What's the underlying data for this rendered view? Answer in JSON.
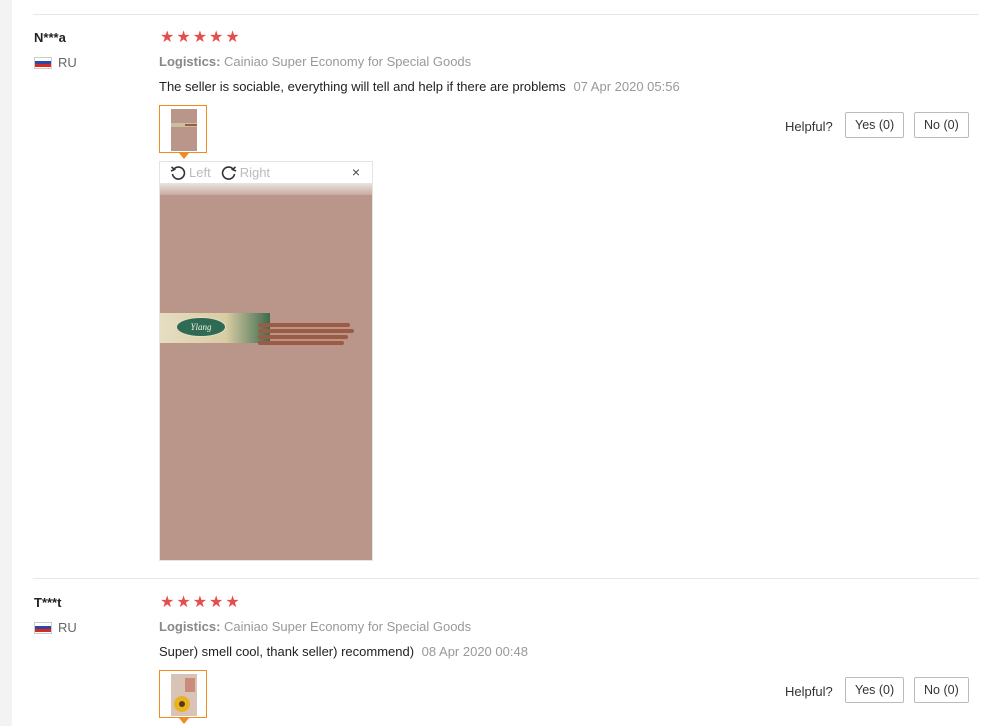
{
  "reviews": [
    {
      "user": "N***a",
      "country": "RU",
      "stars": 5,
      "logistics_label": "Logistics:",
      "logistics_value": "Cainiao Super Economy for Special Goods",
      "text": "The seller is sociable, everything will tell and help if there are problems",
      "date": "07 Apr 2020 05:56",
      "helpful_label": "Helpful?",
      "yes_label": "Yes (0)",
      "no_label": "No (0)",
      "viewer": {
        "left_label": "Left",
        "right_label": "Right",
        "close_label": "×",
        "image_text": "Ylang"
      }
    },
    {
      "user": "T***t",
      "country": "RU",
      "stars": 5,
      "logistics_label": "Logistics:",
      "logistics_value": "Cainiao Super Economy for Special Goods",
      "text": "Super) smell cool, thank seller) recommend)",
      "date": "08 Apr 2020 00:48",
      "helpful_label": "Helpful?",
      "yes_label": "Yes (0)",
      "no_label": "No (0)"
    }
  ],
  "icons": {
    "star": "★",
    "rotate_left": "rotate-left-icon",
    "rotate_right": "rotate-right-icon",
    "close": "close-icon",
    "flag": "russia-flag-icon"
  },
  "colors": {
    "star": "#e84d4d",
    "thumb_border": "#f08b1f",
    "flag_white": "#ffffff",
    "flag_blue": "#2a49a8",
    "flag_red": "#d52b1e"
  }
}
